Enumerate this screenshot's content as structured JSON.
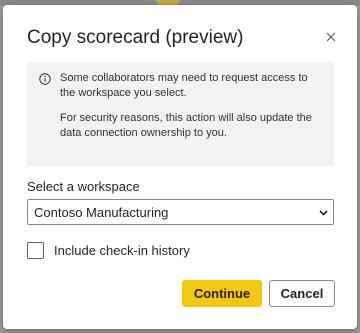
{
  "dialog": {
    "title": "Copy scorecard (preview)",
    "close_icon": "close-icon",
    "info": {
      "icon": "info-icon",
      "line1": "Some collaborators may need to request access to the workspace you select.",
      "line2": "For security reasons, this action will also update the data connection ownership to you."
    },
    "workspace": {
      "label": "Select a workspace",
      "selected": "Contoso Manufacturing",
      "chevron_icon": "chevron-down-icon"
    },
    "checkbox": {
      "label": "Include check-in history",
      "checked": false
    },
    "buttons": {
      "continue_label": "Continue",
      "cancel_label": "Cancel"
    }
  },
  "colors": {
    "primary": "#f2c811",
    "info_bg": "#f3f2f1",
    "text": "#252423"
  }
}
